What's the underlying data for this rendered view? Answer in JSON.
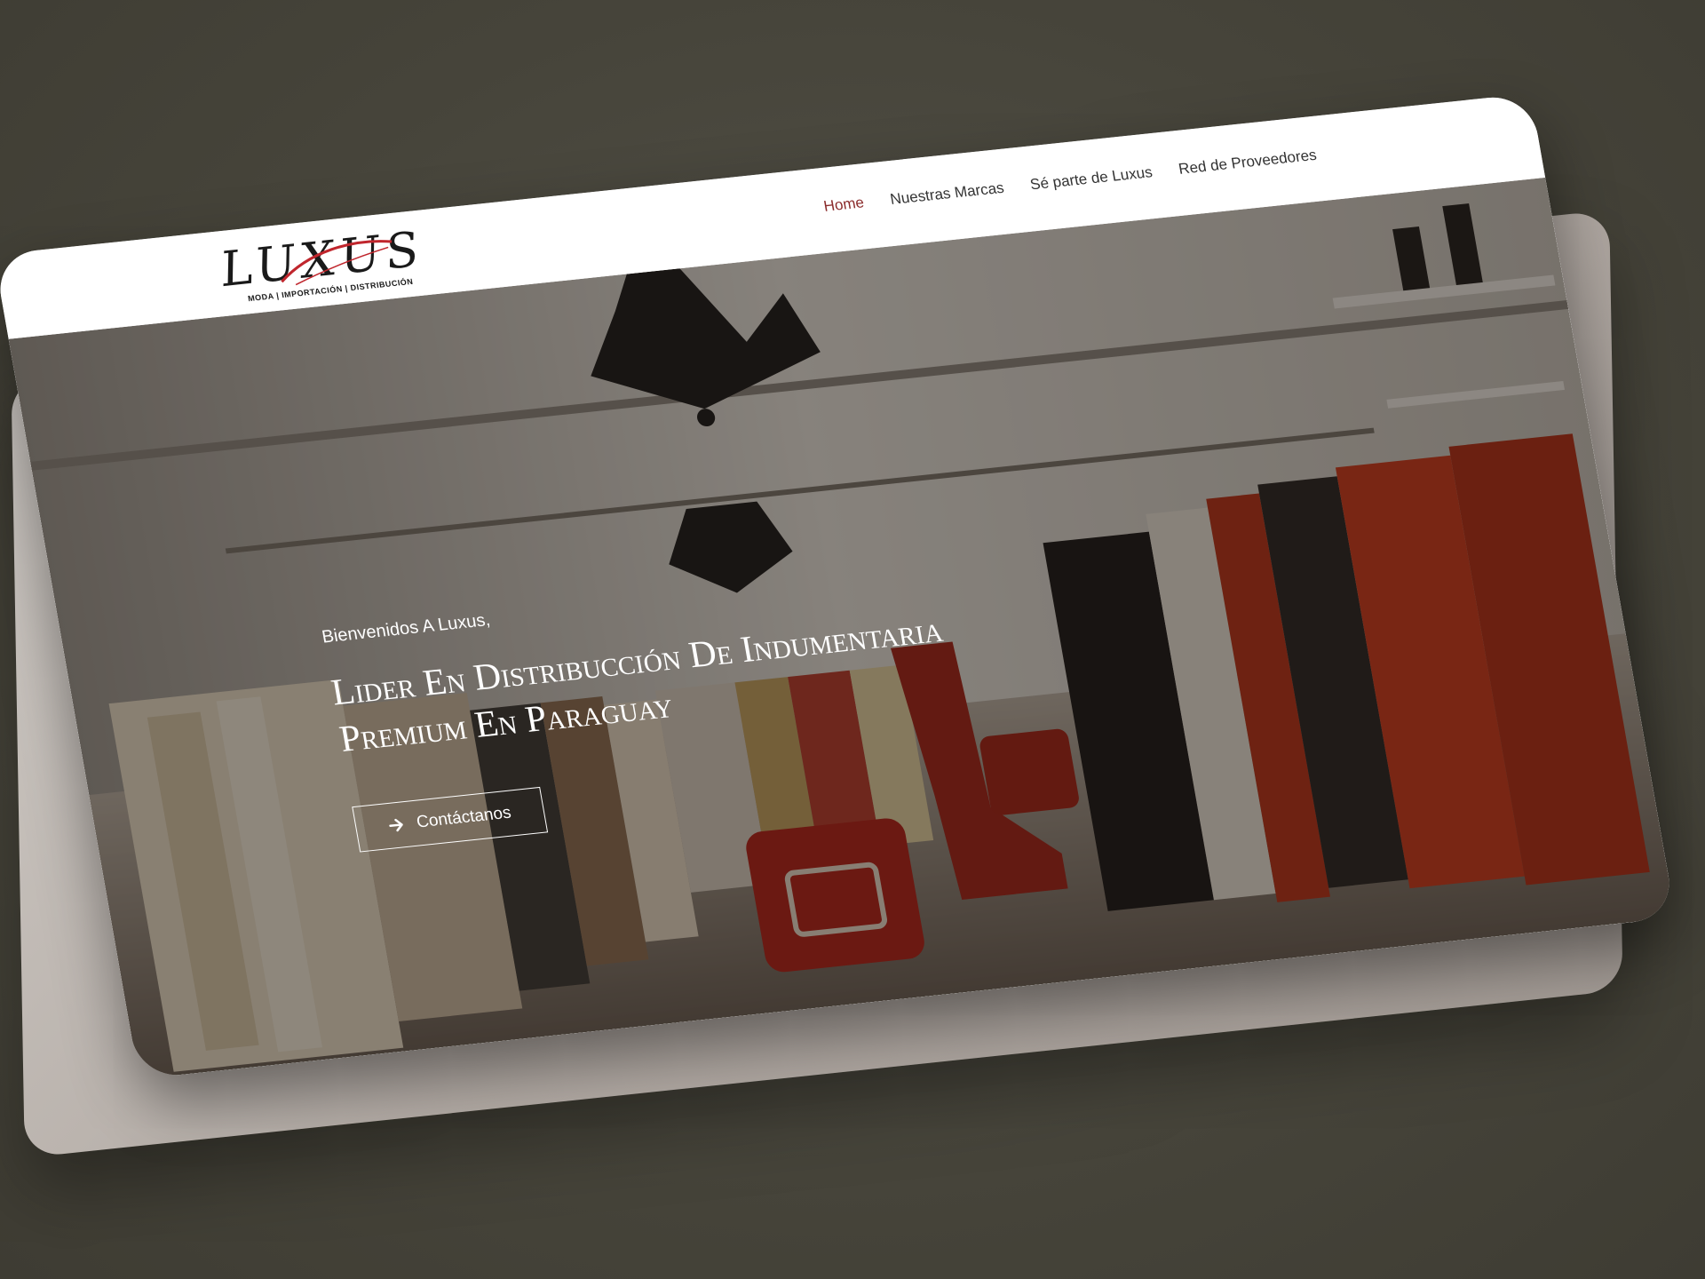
{
  "brand": {
    "logo_text": "LUXUS",
    "logo_tagline": "MODA | IMPORTACIÓN | DISTRIBUCIÓN",
    "accent_color": "#8b2b2b",
    "logo_swoosh_color": "#c0262d"
  },
  "nav": {
    "items": [
      {
        "label": "Home",
        "active": true
      },
      {
        "label": "Nuestras Marcas",
        "active": false
      },
      {
        "label": "Sé parte de Luxus",
        "active": false
      },
      {
        "label": "Red de Proveedores",
        "active": false
      }
    ]
  },
  "hero": {
    "welcome": "Bienvenidos A Luxus,",
    "title_line1": "Lider En Distribucción De Indumentaria",
    "title_line2": "Premium En Paraguay",
    "cta_label": "Contáctanos",
    "cta_icon": "arrow-right-icon"
  }
}
